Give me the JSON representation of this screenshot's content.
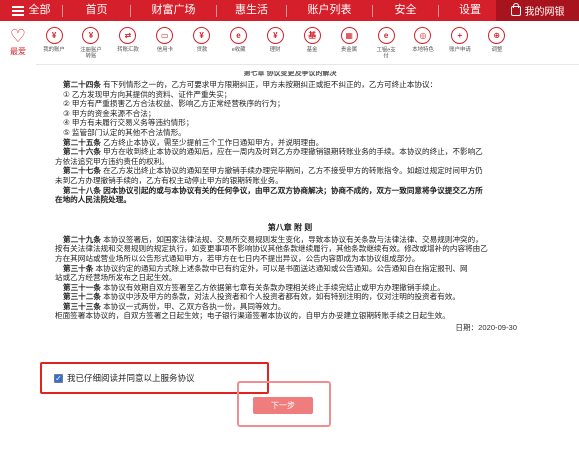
{
  "topnav": {
    "items": [
      "全部",
      "首页",
      "财富广场",
      "惠生活",
      "账户列表",
      "安全",
      "设置"
    ],
    "my_bank": "我的网银"
  },
  "toolbar": {
    "favorite": "最爱",
    "items": [
      {
        "label": "我的账户",
        "glyph": "¥"
      },
      {
        "label": "注册账户\n转账",
        "glyph": "¥"
      },
      {
        "label": "转账汇款",
        "glyph": "⇄"
      },
      {
        "label": "信用卡",
        "glyph": "▭"
      },
      {
        "label": "贷款",
        "glyph": "¥"
      },
      {
        "label": "e收藏",
        "glyph": "e"
      },
      {
        "label": "理财",
        "glyph": "¥"
      },
      {
        "label": "基金",
        "glyph": "基"
      },
      {
        "label": "贵金属",
        "glyph": "▦"
      },
      {
        "label": "工银e支付",
        "glyph": "e"
      },
      {
        "label": "本地特色",
        "glyph": "◎"
      },
      {
        "label": "账户申请",
        "glyph": "+"
      },
      {
        "label": "调整",
        "glyph": "⊕"
      }
    ]
  },
  "content": {
    "chapter_cut": "第七章 协议变更及争议的解决",
    "art24_head": "第二十四条",
    "art24_text": "有下列情形之一的，乙方可要求甲方限期纠正，甲方未按期纠正或拒不纠正的，乙方可终止本协议：",
    "list": [
      "① 乙方发现甲方向其提供的资料、证件严重失实；",
      "② 甲方有严重损害乙方合法权益、影响乙方正常经营秩序的行为；",
      "③ 甲方的资金来源不合法；",
      "④ 甲方有未履行交易义务等违约情形；",
      "⑤ 监管部门认定的其他不合法情形。"
    ],
    "art25_head": "第二十五条",
    "art25_text": "乙方终止本协议，需至少提前三个工作日通知甲方，并说明理由。",
    "art26_head": "第二十六条",
    "art26_text": "甲方在收到终止本协议的通知后，应在一周内及时到乙方办理撤销银期转账业务的手续。本协议的终止，不影响乙",
    "art26_cont": "方依法追究甲方违约责任的权利。",
    "art27_head": "第二十七条",
    "art27_text": "在乙方发出终止本协议的通知至甲方撤销手续办理完毕期间，乙方不接受甲方的转账指令。如超过规定时间甲方仍",
    "art27_cont": "未到乙方办理撤销手续的，乙方有权主动停止甲方的银期转账业务。",
    "art28_head": "第二十八条",
    "art28_text": "因本协议引起的或与本协议有关的任何争议，由甲乙双方协商解决；协商不成的，双方一致同意将争议提交乙方所",
    "art28_cont": "在地的人民法院处理。",
    "chapter8": "第八章 附 则",
    "art29_head": "第二十九条",
    "art29_text": "本协议签署后，如国家法律法规、交易所交易规则发生变化，导致本协议有关条款与法律法律、交易规则冲突的，",
    "art29_cont1": "按有关法律法规和交易规则的规定执行，如变更事项不影响协议其他条款继续履行，其他条款继续有效。修改或增补的内容将由乙",
    "art29_cont2": "方在其网站或营业场所以公告形式通知甲方，若甲方在七日内不提出异议，公告内容即成为本协议组成部分。",
    "art30_head": "第三十条",
    "art30_text": "本协议约定的通知方式除上述条款中已有约定外，可以是书面送达通知或公告通知。公告通知自在指定报刊、网",
    "art30_cont": "站或乙方经营场所发布之日起生效。",
    "art31_head": "第三十一条",
    "art31_text": "本协议有效期自双方签署至乙方依据第七章有关条款办理相关终止手续完结止或甲方办理撤销手续止。",
    "art32_head": "第三十二条",
    "art32_text": "本协议中涉及甲方的条款，对法人投资者和个人投资者都有效，如有特别注明的，仅对注明的投资者有效。",
    "art33_head": "第三十三条",
    "art33_text": "本协议一式两份，甲、乙双方各执一份，具同等效力。",
    "closing": "柜面签署本协议的，自双方签署之日起生效；电子银行渠道签署本协议的，自甲方办妥建立银期转账手续之日起生效。",
    "date": "日期：2020-09-30"
  },
  "agree": {
    "checked": true,
    "label": "我已仔细阅读并同意以上服务协议"
  },
  "next_button": "下一步"
}
